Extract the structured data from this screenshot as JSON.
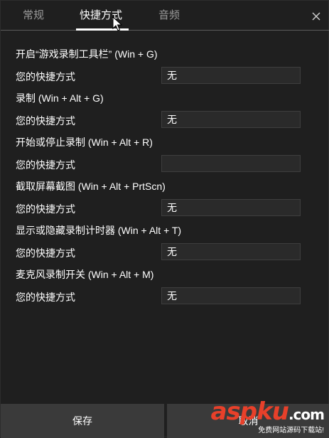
{
  "tabs": [
    {
      "label": "常规"
    },
    {
      "label": "快捷方式"
    },
    {
      "label": "音频"
    }
  ],
  "sections": [
    {
      "title": "开启“游戏录制工具栏” (Win + G)",
      "row_label": "您的快捷方式",
      "value": "无"
    },
    {
      "title": "录制 (Win + Alt + G)",
      "row_label": "您的快捷方式",
      "value": "无"
    },
    {
      "title": "开始或停止录制 (Win + Alt + R)",
      "row_label": "您的快捷方式",
      "value": ""
    },
    {
      "title": "截取屏幕截图 (Win + Alt + PrtScn)",
      "row_label": "您的快捷方式",
      "value": "无"
    },
    {
      "title": "显示或隐藏录制计时器 (Win + Alt + T)",
      "row_label": "您的快捷方式",
      "value": "无"
    },
    {
      "title": "麦克风录制开关 (Win + Alt + M)",
      "row_label": "您的快捷方式",
      "value": "无"
    }
  ],
  "footer": {
    "save_label": "保存",
    "cancel_label": "取消"
  },
  "watermark": {
    "brand_a": "asp",
    "brand_b": "ku",
    "brand_c": ".com",
    "sub": "免费网站源码下载站!"
  },
  "icons": {
    "close": "close-icon",
    "cursor": "mouse-cursor-icon"
  },
  "colors": {
    "background": "#1f1f1f",
    "input_background": "#2a2a2a",
    "button_background": "#3a3a3a",
    "active_tab": "#ffffff",
    "inactive_tab": "#9a9a9a",
    "watermark_red": "#e8402a"
  }
}
